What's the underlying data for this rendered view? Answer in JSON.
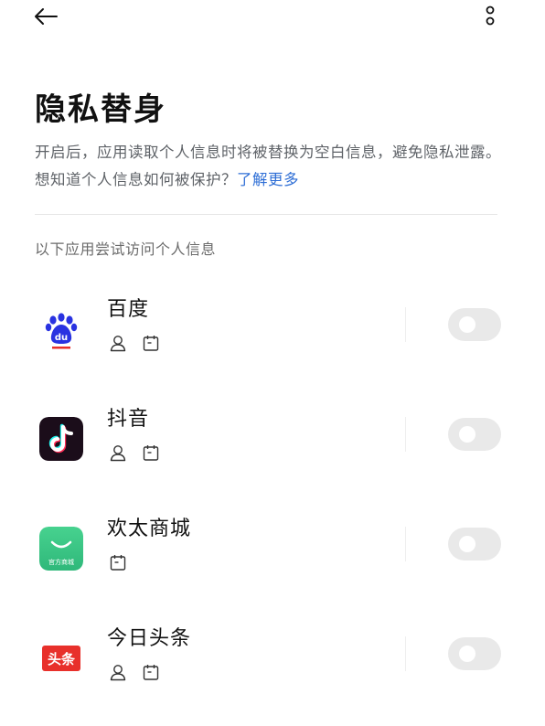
{
  "header": {
    "back_icon": "arrow-left-icon",
    "more_icon": "more-vertical-icon"
  },
  "page": {
    "title": "隐私替身",
    "description": "开启后，应用读取个人信息时将被替换为空白信息，避免隐私泄露。想知道个人信息如何被保护？",
    "learn_more": "了解更多",
    "section_label": "以下应用尝试访问个人信息"
  },
  "apps": [
    {
      "name": "百度",
      "icon": "baidu-app-icon",
      "permissions": [
        "contacts-icon",
        "calendar-icon"
      ],
      "enabled": false
    },
    {
      "name": "抖音",
      "icon": "douyin-app-icon",
      "permissions": [
        "contacts-icon",
        "calendar-icon"
      ],
      "enabled": false
    },
    {
      "name": "欢太商城",
      "icon": "heytap-mall-app-icon",
      "icon_label": "官方商城",
      "permissions": [
        "calendar-icon"
      ],
      "enabled": false
    },
    {
      "name": "今日头条",
      "icon": "toutiao-app-icon",
      "icon_label": "头条",
      "permissions": [
        "contacts-icon",
        "calendar-icon"
      ],
      "enabled": false
    }
  ],
  "colors": {
    "link": "#2f6fd6",
    "toggle_off": "#e9e9e9",
    "baidu_blue": "#2932e1",
    "douyin_bg": "#1b0d1a",
    "heytap_green": "#3ec48a",
    "toutiao_red": "#e8302b"
  }
}
